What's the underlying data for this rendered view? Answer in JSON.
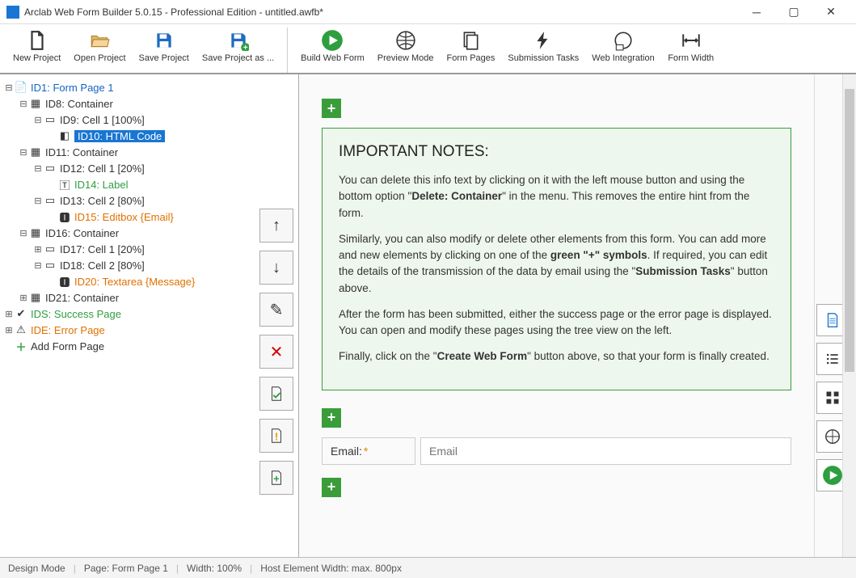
{
  "title": "Arclab Web Form Builder 5.0.15 - Professional Edition - untitled.awfb*",
  "toolbar": {
    "new_project": "New Project",
    "open_project": "Open Project",
    "save_project": "Save Project",
    "save_project_as": "Save Project as ...",
    "build_web_form": "Build Web Form",
    "preview_mode": "Preview Mode",
    "form_pages": "Form Pages",
    "submission_tasks": "Submission Tasks",
    "web_integration": "Web Integration",
    "form_width": "Form Width"
  },
  "tree": {
    "id1": "ID1: Form Page 1",
    "id8": "ID8: Container",
    "id9": "ID9: Cell 1 [100%]",
    "id10": "ID10: HTML Code",
    "id11": "ID11: Container",
    "id12": "ID12: Cell 1 [20%]",
    "id14": "ID14: Label",
    "id13": "ID13: Cell 2 [80%]",
    "id15": "ID15: Editbox {Email}",
    "id16": "ID16: Container",
    "id17": "ID17: Cell 1 [20%]",
    "id18": "ID18: Cell 2 [80%]",
    "id20": "ID20: Textarea {Message}",
    "id21": "ID21: Container",
    "ids": "IDS: Success Page",
    "ide": "IDE: Error Page",
    "add_form_page": "Add Form Page"
  },
  "notes": {
    "title": "IMPORTANT NOTES:",
    "p1a": "You can delete this info text by clicking on it with the left mouse button and using the bottom option \"",
    "p1b": "Delete: Container",
    "p1c": "\" in the menu. This removes the entire hint from the form.",
    "p2a": "Similarly, you can also modify or delete other elements from this form. You can add more and new elements by clicking on one of the ",
    "p2b": "green \"+\" symbols",
    "p2c": ". If required, you can edit the details of the transmission of the data by email using the \"",
    "p2d": "Submission Tasks",
    "p2e": "\" button above.",
    "p3": "After the form has been submitted, either the success page or the error page is displayed. You can open and modify these pages using the tree view on the left.",
    "p4a": "Finally, click on the \"",
    "p4b": "Create Web Form",
    "p4c": "\" button above, so that your form is finally created."
  },
  "form": {
    "email_label": "Email:",
    "email_required": "*",
    "email_placeholder": "Email"
  },
  "status": {
    "mode": "Design Mode",
    "page": "Page: Form Page 1",
    "width": "Width: 100%",
    "host": "Host Element Width: max. 800px"
  }
}
